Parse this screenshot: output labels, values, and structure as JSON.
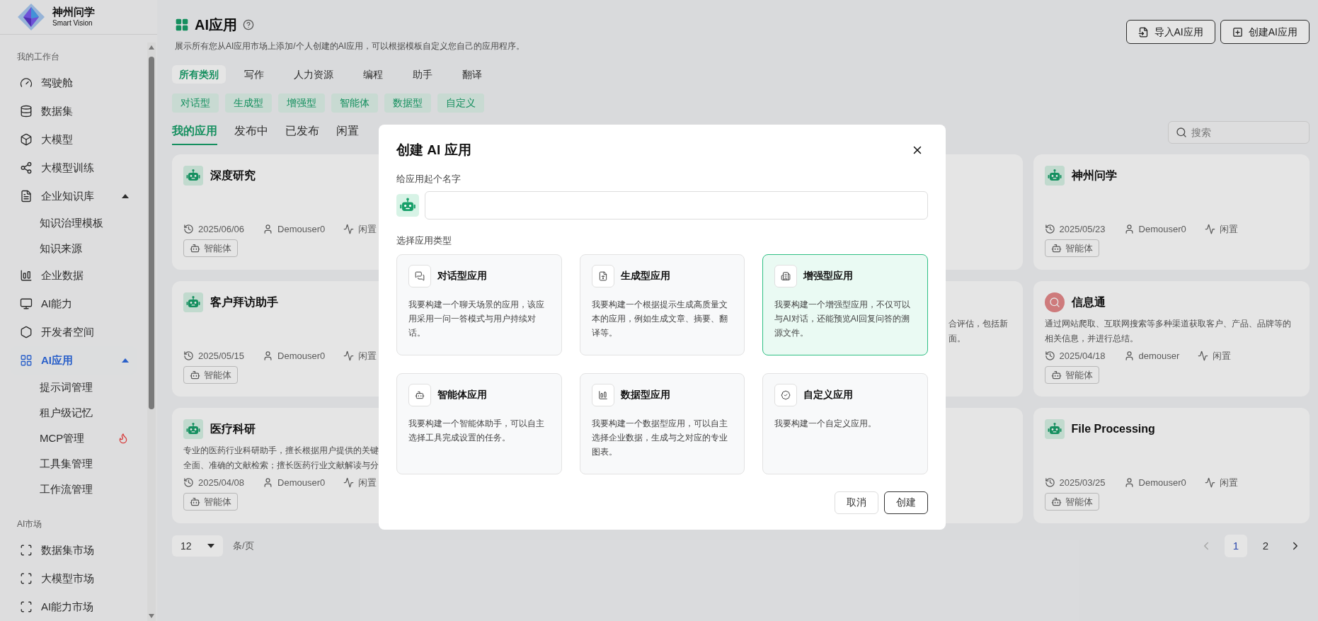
{
  "logo": {
    "title": "神州问学",
    "subtitle": "Smart Vision"
  },
  "sidebar": {
    "sections": [
      {
        "label": "我的工作台",
        "items": [
          {
            "label": "驾驶舱",
            "selected": false
          },
          {
            "label": "数据集",
            "selected": false
          },
          {
            "label": "大模型",
            "selected": false
          },
          {
            "label": "大模型训练",
            "selected": false
          },
          {
            "label": "企业知识库",
            "selected": false,
            "expanded": true,
            "children": [
              {
                "label": "知识治理模板",
                "selected": false,
                "hot": false
              },
              {
                "label": "知识来源",
                "selected": false,
                "hot": false
              }
            ]
          },
          {
            "label": "企业数据",
            "selected": false
          },
          {
            "label": "AI能力",
            "selected": false
          },
          {
            "label": "开发者空间",
            "selected": false
          },
          {
            "label": "AI应用",
            "selected": true,
            "expanded": true,
            "children": [
              {
                "label": "提示词管理",
                "selected": false,
                "hot": false
              },
              {
                "label": "租户级记忆",
                "selected": false,
                "hot": false
              },
              {
                "label": "MCP管理",
                "selected": false,
                "hot": true
              },
              {
                "label": "工具集管理",
                "selected": false,
                "hot": false
              },
              {
                "label": "工作流管理",
                "selected": false,
                "hot": false
              }
            ]
          }
        ]
      },
      {
        "label": "AI市场",
        "items": [
          {
            "label": "数据集市场",
            "selected": false
          },
          {
            "label": "大模型市场",
            "selected": false
          },
          {
            "label": "AI能力市场",
            "selected": false
          }
        ]
      }
    ]
  },
  "header": {
    "title": "AI应用",
    "description": "展示所有您从AI应用市场上添加/个人创建的AI应用，可以根据模板自定义您自己的应用程序。",
    "buttons": [
      "导入AI应用",
      "创建AI应用"
    ]
  },
  "categories": [
    {
      "label": "所有类别",
      "selected": true
    },
    {
      "label": "写作",
      "selected": false
    },
    {
      "label": "人力资源",
      "selected": false
    },
    {
      "label": "编程",
      "selected": false
    },
    {
      "label": "助手",
      "selected": false
    },
    {
      "label": "翻译",
      "selected": false
    }
  ],
  "type_tags": [
    "对话型",
    "生成型",
    "增强型",
    "智能体",
    "数据型",
    "自定义"
  ],
  "tabs": [
    {
      "label": "我的应用",
      "selected": true
    },
    {
      "label": "发布中",
      "selected": false
    },
    {
      "label": "已发布",
      "selected": false
    },
    {
      "label": "闲置",
      "selected": false
    }
  ],
  "search": {
    "placeholder": "搜索"
  },
  "cards": [
    {
      "kind": "bot",
      "name": "深度研究",
      "date": "2025/06/06",
      "user": "Demouser0",
      "status": "闲置",
      "tag": "智能体"
    },
    {
      "kind": "covered"
    },
    {
      "kind": "bot",
      "name": "神州问学",
      "date": "2025/05/23",
      "user": "Demouser0",
      "status": "闲置",
      "tag": "智能体"
    },
    {
      "kind": "bot",
      "name": "客户拜访助手",
      "date": "2025/05/15",
      "user": "Demouser0",
      "status": "闲置",
      "tag": "智能体"
    },
    {
      "kind": "covered",
      "description_lines": [
        "合评估，包括新",
        "面。"
      ]
    },
    {
      "kind": "search",
      "name": "信息通",
      "description_lines": [
        "通过网站爬取、互联网搜索等多种渠道获取客户、产品、品牌等的",
        "相关信息，并进行总结。"
      ],
      "date": "2025/04/18",
      "user": "demouser",
      "status": "闲置",
      "tag": "智能体"
    },
    {
      "kind": "bot",
      "name": "医疗科研",
      "description_lines": [
        "专业的医药行业科研助手，擅长根据用户提供的关键",
        "全面、准确的文献检索；擅长医药行业文献解读与分"
      ],
      "date": "2025/04/08",
      "user": "Demouser0",
      "status": "闲置",
      "tag": "智能体"
    },
    {
      "kind": "covered"
    },
    {
      "kind": "bot",
      "name": "File Processing",
      "date": "2025/03/25",
      "user": "Demouser0",
      "status": "闲置",
      "tag": "智能体"
    }
  ],
  "pagination": {
    "page_size": "12",
    "unit": "条/页",
    "prev_disabled": true,
    "next_disabled": false,
    "pages": [
      {
        "label": "1",
        "selected": true
      },
      {
        "label": "2",
        "selected": false
      }
    ]
  },
  "dialog": {
    "title": "创建 AI 应用",
    "name_label": "给应用起个名字",
    "type_label": "选择应用类型",
    "types": [
      {
        "kind": "chat",
        "title": "对话型应用",
        "description": "我要构建一个聊天场景的应用，该应用采用一问一答模式与用户持续对话。",
        "selected": false
      },
      {
        "kind": "generate",
        "title": "生成型应用",
        "description": "我要构建一个根据提示生成高质量文本的应用，例如生成文章、摘要、翻译等。",
        "selected": false
      },
      {
        "kind": "enhance",
        "title": "增强型应用",
        "description": "我要构建一个增强型应用，不仅可以与AI对话，还能预览AI回复问答的溯源文件。",
        "selected": true
      },
      {
        "kind": "agent",
        "title": "智能体应用",
        "description": "我要构建一个智能体助手，可以自主选择工具完成设置的任务。",
        "selected": false
      },
      {
        "kind": "data",
        "title": "数据型应用",
        "description": "我要构建一个数据型应用，可以自主选择企业数据，生成与之对应的专业图表。",
        "selected": false
      },
      {
        "kind": "custom",
        "title": "自定义应用",
        "description": "我要构建一个自定义应用。",
        "selected": false
      }
    ],
    "buttons": [
      "取消",
      "创建"
    ]
  }
}
